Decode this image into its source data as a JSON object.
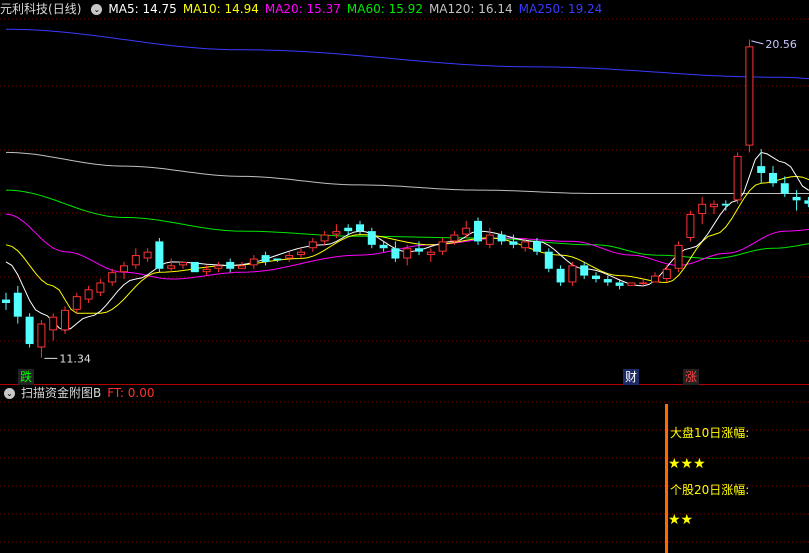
{
  "colors": {
    "background": "#000000",
    "up": "#ff3232",
    "down": "#54ffff",
    "ma5": "#ffffff",
    "ma10": "#ffff00",
    "ma20": "#ff00ff",
    "ma60": "#00e600",
    "ma120": "#c0c0c0",
    "ma250": "#3a3aff",
    "grid": "#7a0000",
    "separator": "#b40000"
  },
  "main_header": {
    "stock_name": "元利科技",
    "period": "(日线)",
    "toggle_icon": "chevron-down-icon",
    "ma5": "MA5: 14.75",
    "ma10": "MA10: 14.94",
    "ma20": "MA20: 15.37",
    "ma60": "MA60: 15.92",
    "ma120": "MA120: 16.14",
    "ma250": "MA250: 19.24"
  },
  "sub_header": {
    "title": "扫描资金附图B",
    "ft": "FT: 0.00",
    "toggle_icon": "chevron-down-icon"
  },
  "markers": {
    "high_label": "20.56",
    "low_label": "11.34",
    "badge_die": "跌",
    "badge_cai": "财",
    "badge_zhang": "涨"
  },
  "sub_panel": {
    "line1": "大盘10日涨幅:",
    "stars1": "★★★",
    "line2": "个股20日涨幅:",
    "stars2": "★★"
  },
  "chart_data": [
    {
      "type": "candlestick",
      "ylim": [
        11.0,
        21.2
      ],
      "price_markers": {
        "high": 20.56,
        "low": 11.34
      },
      "candles": [
        [
          13.0,
          13.2,
          12.7,
          12.9
        ],
        [
          13.2,
          13.4,
          12.3,
          12.5
        ],
        [
          12.5,
          12.6,
          11.6,
          11.7
        ],
        [
          11.6,
          12.4,
          11.3,
          12.3
        ],
        [
          12.1,
          12.6,
          11.8,
          12.5
        ],
        [
          12.1,
          12.8,
          12.0,
          12.7
        ],
        [
          12.7,
          13.2,
          12.6,
          13.1
        ],
        [
          13.0,
          13.4,
          12.9,
          13.3
        ],
        [
          13.2,
          13.6,
          13.1,
          13.5
        ],
        [
          13.5,
          13.9,
          13.4,
          13.8
        ],
        [
          13.8,
          14.1,
          13.6,
          14.0
        ],
        [
          14.0,
          14.5,
          13.9,
          14.3
        ],
        [
          14.2,
          14.5,
          14.1,
          14.4
        ],
        [
          14.7,
          14.8,
          13.8,
          13.9
        ],
        [
          13.9,
          14.2,
          13.8,
          14.0
        ],
        [
          14.0,
          14.1,
          13.9,
          14.1
        ],
        [
          14.1,
          14.1,
          13.8,
          13.8
        ],
        [
          13.8,
          14.0,
          13.7,
          13.9
        ],
        [
          13.9,
          14.1,
          13.8,
          14.0
        ],
        [
          14.1,
          14.2,
          13.8,
          13.9
        ],
        [
          13.9,
          14.1,
          13.9,
          14.0
        ],
        [
          14.0,
          14.3,
          13.9,
          14.2
        ],
        [
          14.3,
          14.4,
          14.0,
          14.1
        ],
        [
          14.2,
          14.2,
          14.1,
          14.15
        ],
        [
          14.2,
          14.4,
          14.1,
          14.3
        ],
        [
          14.3,
          14.5,
          14.2,
          14.4
        ],
        [
          14.5,
          14.8,
          14.4,
          14.7
        ],
        [
          14.7,
          15.0,
          14.6,
          14.9
        ],
        [
          14.9,
          15.2,
          14.8,
          15.0
        ],
        [
          15.1,
          15.2,
          14.9,
          15.0
        ],
        [
          15.2,
          15.3,
          14.9,
          15.0
        ],
        [
          15.0,
          15.1,
          14.5,
          14.6
        ],
        [
          14.6,
          14.7,
          14.4,
          14.5
        ],
        [
          14.5,
          14.7,
          14.1,
          14.2
        ],
        [
          14.2,
          14.6,
          14.0,
          14.5
        ],
        [
          14.5,
          14.7,
          14.3,
          14.4
        ],
        [
          14.3,
          14.5,
          14.1,
          14.4
        ],
        [
          14.4,
          14.8,
          14.3,
          14.7
        ],
        [
          14.7,
          15.0,
          14.6,
          14.9
        ],
        [
          14.9,
          15.3,
          14.8,
          15.1
        ],
        [
          15.3,
          15.4,
          14.6,
          14.7
        ],
        [
          14.6,
          15.1,
          14.5,
          14.9
        ],
        [
          14.9,
          15.0,
          14.6,
          14.7
        ],
        [
          14.7,
          14.9,
          14.5,
          14.6
        ],
        [
          14.5,
          14.8,
          14.4,
          14.7
        ],
        [
          14.7,
          14.8,
          14.3,
          14.4
        ],
        [
          14.4,
          14.5,
          13.8,
          13.9
        ],
        [
          13.9,
          14.0,
          13.4,
          13.5
        ],
        [
          13.5,
          14.1,
          13.4,
          14.0
        ],
        [
          14.0,
          14.1,
          13.6,
          13.7
        ],
        [
          13.7,
          13.8,
          13.5,
          13.6
        ],
        [
          13.6,
          13.7,
          13.4,
          13.5
        ],
        [
          13.5,
          13.6,
          13.3,
          13.4
        ],
        [
          13.4,
          13.5,
          13.4,
          13.5
        ],
        [
          13.5,
          13.6,
          13.4,
          13.5
        ],
        [
          13.5,
          13.8,
          13.5,
          13.7
        ],
        [
          13.6,
          14.0,
          13.5,
          13.9
        ],
        [
          13.9,
          14.7,
          13.8,
          14.6
        ],
        [
          14.8,
          15.6,
          14.7,
          15.5
        ],
        [
          15.5,
          16.0,
          15.2,
          15.8
        ],
        [
          15.7,
          15.9,
          15.5,
          15.8
        ],
        [
          15.8,
          15.9,
          15.6,
          15.75
        ],
        [
          15.9,
          17.3,
          15.8,
          17.2
        ],
        [
          17.5,
          20.6,
          17.3,
          20.4
        ],
        [
          16.9,
          17.4,
          16.4,
          16.7
        ],
        [
          16.7,
          16.9,
          16.3,
          16.4
        ],
        [
          16.4,
          16.6,
          16.0,
          16.1
        ],
        [
          16.0,
          16.2,
          15.6,
          15.9
        ],
        [
          15.9,
          16.0,
          15.7,
          15.8
        ],
        [
          15.8,
          16.2,
          15.7,
          16.0
        ],
        [
          16.0,
          16.2,
          15.8,
          15.9
        ],
        [
          15.9,
          16.1,
          15.7,
          15.8
        ],
        [
          15.8,
          16.0,
          15.5,
          15.6
        ],
        [
          15.6,
          15.8,
          15.3,
          15.4
        ]
      ],
      "ma_series": [
        {
          "name": "MA250",
          "anchors": [
            [
              0,
              20.9
            ],
            [
              20,
              20.3
            ],
            [
              45,
              19.8
            ],
            [
              65,
              19.5
            ],
            [
              75,
              19.3
            ]
          ]
        },
        {
          "name": "MA120",
          "anchors": [
            [
              0,
              17.3
            ],
            [
              10,
              16.9
            ],
            [
              20,
              16.6
            ],
            [
              30,
              16.35
            ],
            [
              40,
              16.2
            ],
            [
              50,
              16.1
            ],
            [
              60,
              16.1
            ],
            [
              75,
              16.1
            ]
          ]
        },
        {
          "name": "MA60",
          "anchors": [
            [
              0,
              16.2
            ],
            [
              10,
              15.4
            ],
            [
              20,
              15.0
            ],
            [
              30,
              14.85
            ],
            [
              40,
              14.8
            ],
            [
              50,
              14.6
            ],
            [
              55,
              14.3
            ],
            [
              60,
              14.2
            ],
            [
              65,
              14.5
            ],
            [
              70,
              14.7
            ],
            [
              75,
              14.8
            ]
          ]
        },
        {
          "name": "MA20",
          "anchors": [
            [
              0,
              15.5
            ],
            [
              5,
              14.4
            ],
            [
              10,
              13.8
            ],
            [
              14,
              13.6
            ],
            [
              20,
              13.8
            ],
            [
              30,
              14.3
            ],
            [
              36,
              14.6
            ],
            [
              42,
              14.8
            ],
            [
              48,
              14.7
            ],
            [
              53,
              14.3
            ],
            [
              57,
              14.0
            ],
            [
              61,
              14.35
            ],
            [
              66,
              15.0
            ],
            [
              70,
              15.1
            ],
            [
              75,
              15.4
            ]
          ]
        },
        {
          "name": "MA10",
          "anchors": [
            [
              0,
              14.6
            ],
            [
              4,
              13.4
            ],
            [
              6,
              12.6
            ],
            [
              8,
              12.6
            ],
            [
              13,
              13.8
            ],
            [
              19,
              14.0
            ],
            [
              25,
              14.2
            ],
            [
              30,
              14.9
            ],
            [
              36,
              14.6
            ],
            [
              41,
              14.8
            ],
            [
              47,
              14.3
            ],
            [
              52,
              13.7
            ],
            [
              56,
              13.5
            ],
            [
              60,
              14.9
            ],
            [
              64,
              16.4
            ],
            [
              67,
              16.6
            ],
            [
              71,
              16.0
            ],
            [
              75,
              15.8
            ]
          ]
        },
        {
          "name": "MA5",
          "anchors": [
            [
              0,
              14.1
            ],
            [
              3,
              12.6
            ],
            [
              5,
              12.1
            ],
            [
              7,
              12.5
            ],
            [
              11,
              13.6
            ],
            [
              14,
              14.1
            ],
            [
              19,
              14.0
            ],
            [
              27,
              14.6
            ],
            [
              30,
              15.0
            ],
            [
              34,
              14.4
            ],
            [
              38,
              14.7
            ],
            [
              40,
              15.0
            ],
            [
              45,
              14.7
            ],
            [
              49,
              13.9
            ],
            [
              54,
              13.4
            ],
            [
              58,
              14.5
            ],
            [
              62,
              15.9
            ],
            [
              64,
              17.3
            ],
            [
              66,
              17.0
            ],
            [
              68,
              16.2
            ],
            [
              71,
              15.9
            ],
            [
              75,
              15.7
            ]
          ]
        }
      ]
    },
    {
      "type": "bar",
      "title": "扫描资金附图B",
      "values": [
        0
      ],
      "ylim": [
        0,
        1
      ]
    }
  ]
}
